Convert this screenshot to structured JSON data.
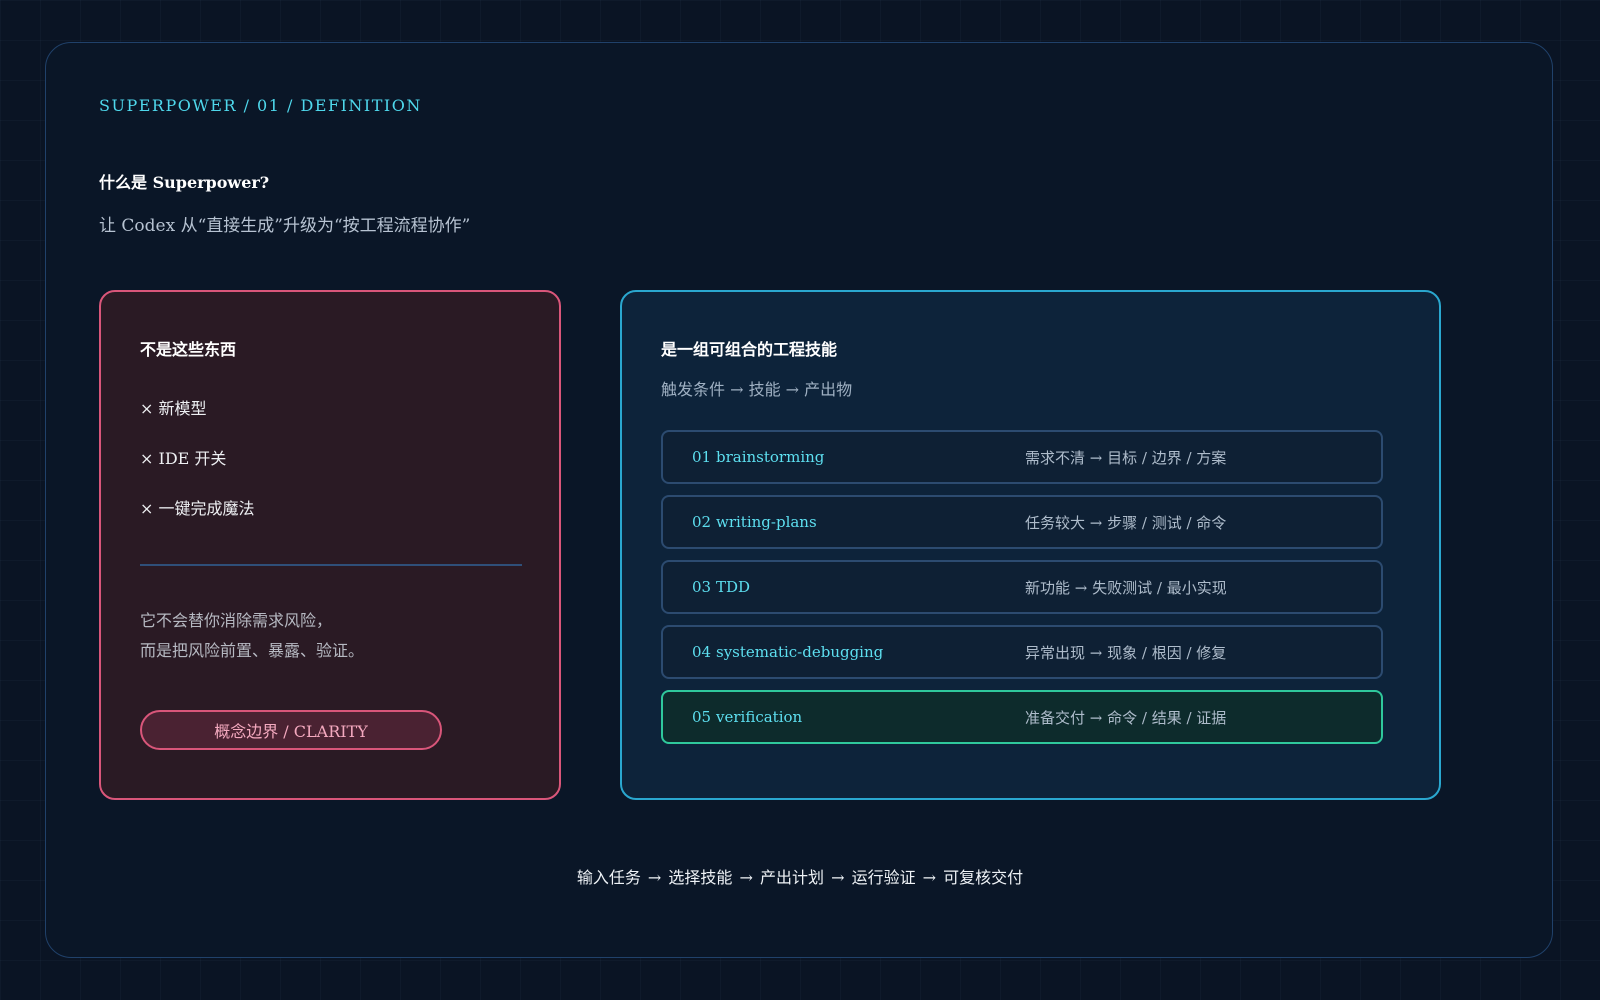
{
  "header": {
    "kicker": "SUPERPOWER / 01 / DEFINITION",
    "title": "什么是 Superpower?",
    "subtitle": "让 Codex 从“直接生成”升级为“按工程流程协作”"
  },
  "not_card": {
    "title": "不是这些东西",
    "items": [
      "× 新模型",
      "× IDE 开关",
      "× 一键完成魔法"
    ],
    "note_lines": [
      "它不会替你消除需求风险，",
      "而是把风险前置、暴露、验证。"
    ],
    "pill_label": "概念边界 / CLARITY"
  },
  "skills_card": {
    "title": "是一组可组合的工程技能",
    "subtitle": "触发条件 → 技能 → 产出物",
    "skills": [
      {
        "num": "01",
        "name": "brainstorming",
        "flow": "需求不清 → 目标 / 边界 / 方案"
      },
      {
        "num": "02",
        "name": "writing-plans",
        "flow": "任务较大 → 步骤 / 测试 / 命令"
      },
      {
        "num": "03",
        "name": "TDD",
        "flow": "新功能 → 失败测试 / 最小实现"
      },
      {
        "num": "04",
        "name": "systematic-debugging",
        "flow": "异常出现 → 现象 / 根因 / 修复"
      },
      {
        "num": "05",
        "name": "verification",
        "flow": "准备交付 → 命令 / 结果 / 证据"
      }
    ],
    "highlighted_index": 4
  },
  "pipeline": "输入任务 → 选择技能 → 产出计划 → 运行验证 → 可复核交付",
  "colors": {
    "accent_cyan": "#4fd8ec",
    "not_card_border": "#d9567a",
    "skills_card_border": "#2aa7cf",
    "highlight_border": "#2fc89c"
  }
}
